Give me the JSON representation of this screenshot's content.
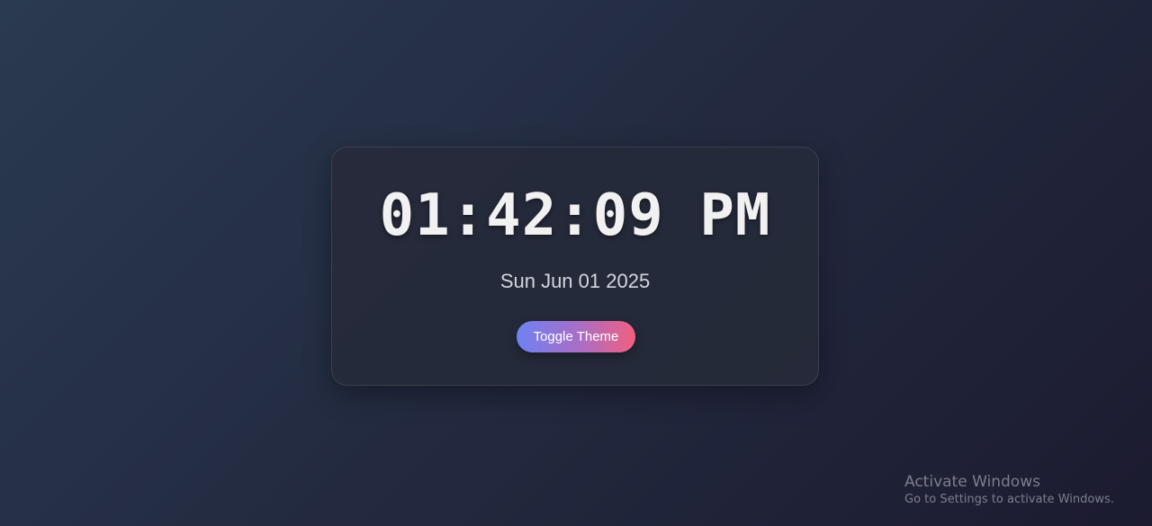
{
  "clock": {
    "time": "01:42:09 PM",
    "date": "Sun Jun 01 2025",
    "toggle_label": "Toggle Theme"
  },
  "watermark": {
    "title": "Activate Windows",
    "subtitle": "Go to Settings to activate Windows."
  },
  "colors": {
    "background_start": "#2a3a50",
    "background_end": "#1c1b30",
    "card_background": "#262a3a",
    "time_text": "#f1f1f1",
    "date_text": "#d4d6de",
    "button_gradient_start": "#6f82f2",
    "button_gradient_end": "#f0607f"
  }
}
